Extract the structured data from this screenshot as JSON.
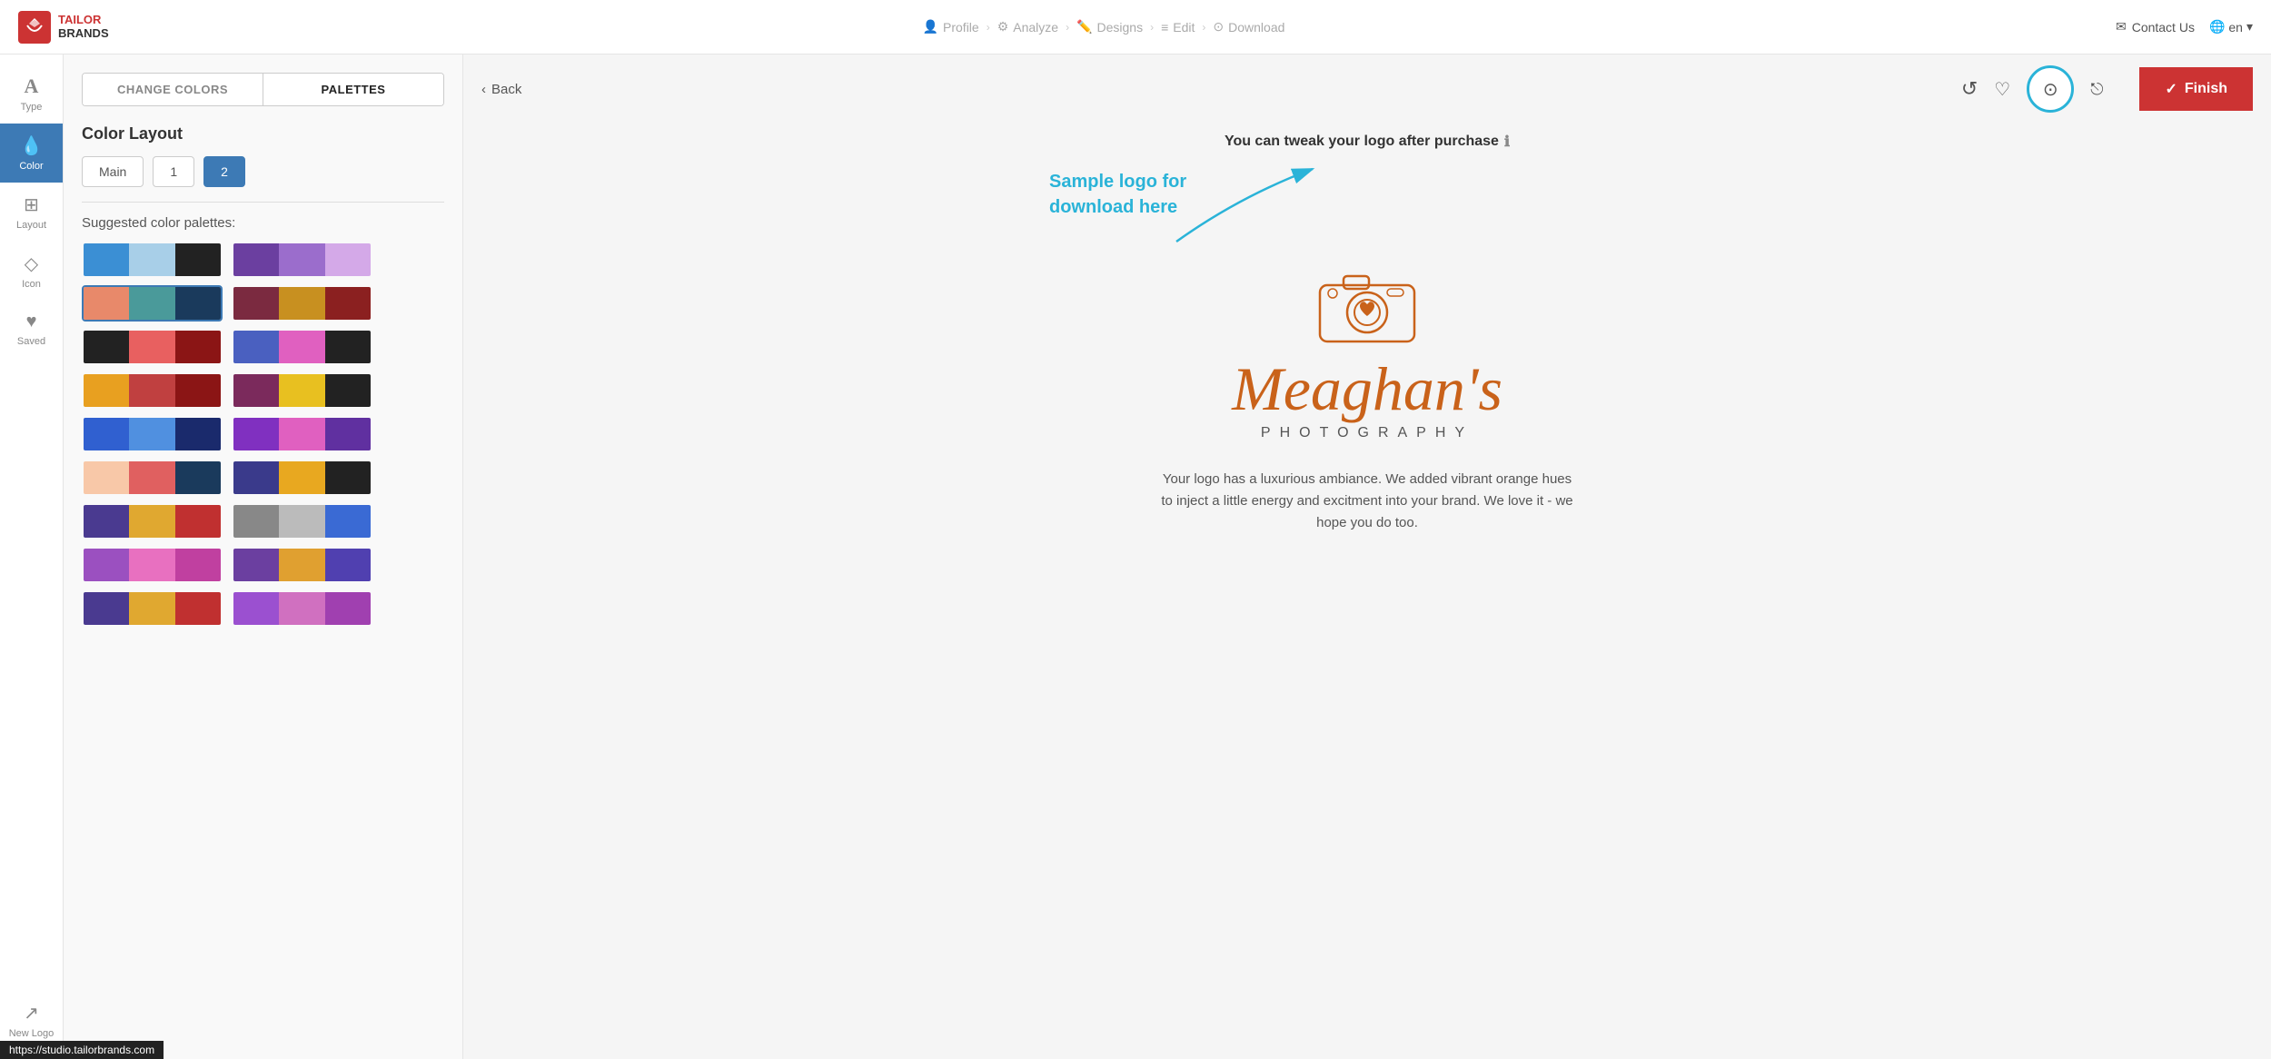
{
  "header": {
    "logo_brand": "TAILOR\nBRANDS",
    "nav_steps": [
      {
        "label": "Profile",
        "icon": "👤",
        "active": false
      },
      {
        "label": "Analyze",
        "icon": "⚙",
        "active": false
      },
      {
        "label": "Designs",
        "icon": "✏️",
        "active": false
      },
      {
        "label": "Edit",
        "icon": "≡",
        "active": false
      },
      {
        "label": "Download",
        "icon": "⊙",
        "active": false
      }
    ],
    "contact_us": "Contact Us",
    "lang": "en"
  },
  "sidebar": {
    "items": [
      {
        "label": "Type",
        "icon": "A",
        "active": false
      },
      {
        "label": "Color",
        "icon": "💧",
        "active": true
      },
      {
        "label": "Layout",
        "icon": "⊞",
        "active": false
      },
      {
        "label": "Icon",
        "icon": "◇",
        "active": false
      },
      {
        "label": "Saved",
        "icon": "♥",
        "active": false
      },
      {
        "label": "New Logo",
        "icon": "↗",
        "active": false
      }
    ]
  },
  "panel": {
    "tabs": [
      {
        "label": "CHANGE COLORS",
        "active": false
      },
      {
        "label": "PALETTES",
        "active": true
      }
    ],
    "color_layout": {
      "title": "Color Layout",
      "options": [
        {
          "label": "Main",
          "active": false
        },
        {
          "label": "1",
          "active": false
        },
        {
          "label": "2",
          "active": true
        }
      ]
    },
    "palettes_title": "Suggested color palettes:",
    "palettes": [
      [
        [
          "#3b8fd4",
          "#a8cfe8",
          "#222222"
        ],
        [
          "#6b3fa0",
          "#9b6dcc",
          "#d4a9e8"
        ]
      ],
      [
        [
          "#2ab5aa",
          "#3d8fb5",
          "#1a3a5c"
        ],
        [
          "#f0c060",
          "#c8882a",
          "#1a3a5c"
        ]
      ],
      [
        [
          "#e8896a",
          "#4a9a9a",
          "#1a3a5c"
        ],
        [
          "#7b2a40",
          "#c89020",
          "#8b2020"
        ]
      ],
      [
        [
          "#222222",
          "#e86060",
          "#8b1515"
        ],
        [
          "#4a60c0",
          "#e060c0",
          "#222222"
        ]
      ],
      [
        [
          "#e8a020",
          "#c04040",
          "#8b1515"
        ],
        [
          "#7b2a5c",
          "#e8c020",
          "#222222"
        ]
      ],
      [
        [
          "#3060d0",
          "#5090e0",
          "#1a2a6c"
        ],
        [
          "#8030c0",
          "#e060c0",
          "#6030a0"
        ]
      ],
      [
        [
          "#f8c8a8",
          "#e06060",
          "#1a3a5c"
        ],
        [
          "#3a3a8b",
          "#e8a820",
          "#222222"
        ]
      ],
      [
        [
          "#4a3a90",
          "#e0a830",
          "#c03030"
        ],
        [
          "#888888",
          "#bbbbbb",
          "#3a6ad4"
        ]
      ],
      [
        [
          "#9b50c0",
          "#e870c0",
          "#c040a0"
        ],
        [
          "#40a050",
          "#2a6aaa",
          "#222222"
        ]
      ]
    ]
  },
  "canvas": {
    "back_label": "Back",
    "tweak_notice": "You can tweak your logo after purchase",
    "sample_label": "Sample logo for\ndownload here",
    "logo_name": "Meaghan's",
    "logo_subtitle": "PHOTOGRAPHY",
    "logo_description": "Your logo has a luxurious ambiance. We added vibrant orange hues to inject a little energy and excitment into your brand. We love it - we hope you do too.",
    "finish_label": "Finish",
    "finish_check": "✓"
  },
  "url_bar": "https://studio.tailorbrands.com"
}
